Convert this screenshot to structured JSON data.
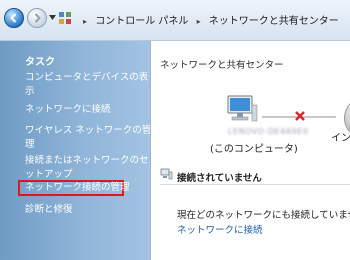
{
  "address_bar": {
    "breadcrumbs": [
      "コントロール パネル",
      "ネットワークと共有センター"
    ],
    "separator": "▸"
  },
  "task_pane": {
    "header": "タスク",
    "tasks": [
      {
        "lines": [
          "コンピュータとデバイスの表",
          "示"
        ]
      },
      {
        "lines": [
          "ネットワークに接続"
        ]
      },
      {
        "lines": [
          "ワイヤレス ネットワークの管",
          "理"
        ]
      },
      {
        "lines": [
          "接続またはネットワークのセ",
          "ットアップ"
        ]
      },
      {
        "lines": [
          "ネットワーク接続の管理"
        ],
        "highlighted": true
      },
      {
        "lines": [
          "診断と修復"
        ]
      }
    ]
  },
  "main": {
    "title": "ネットワークと共有センター",
    "computer_name": "LENOVO-DE4A9E0",
    "computer_label": "(このコンピュータ)",
    "internet_label": "イン",
    "section_title": "接続されていません",
    "message": "現在どのネットワークにも接続していません。",
    "link": "ネットワークに接続"
  },
  "colors": {
    "task_pane": "#8fb5d8",
    "highlight_border": "#e2141e",
    "link": "#1a5fb4",
    "disconnect_x": "#d9262b"
  }
}
